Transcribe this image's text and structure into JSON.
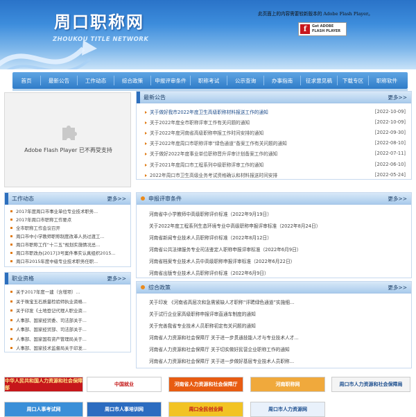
{
  "header": {
    "site_name": "周口职称网",
    "site_name_en": "ZHOUKOU TITLE NETWORK",
    "flash_notice": "此页面上的内容需要较新版本的 Adobe Flash Player。",
    "get_flash_line1": "Get ADOBE",
    "get_flash_line2": "FLASH PLAYER"
  },
  "nav": [
    "首页",
    "最新公告",
    "工作动态",
    "综合政策",
    "申报评审条件",
    "职称考试",
    "公示查询",
    "办事指南",
    "征求意见稿",
    "下载专区",
    "职称软件"
  ],
  "flash_placeholder": "Adobe Flash Player 已不再受支持",
  "latest": {
    "title": "最新公告",
    "more": "更多>>",
    "items": [
      {
        "text": "关于做好我市2022年度卫生高级职称材料报送工作的通知",
        "date": "[2022-10-09]"
      },
      {
        "text": "关于2022年度全市职称评审工作有关问题的通知",
        "date": "[2022-10-09]"
      },
      {
        "text": "关于2022年度河南省高级职称申报工作时间安排的通知",
        "date": "[2022-09-30]"
      },
      {
        "text": "关于2022年度周口市职称评审“绿色通道”备案工作有关问题的通知",
        "date": "[2022-08-10]"
      },
      {
        "text": "关于做好2022年度事业单位职称晋升评审计划备案工作的通知",
        "date": "[2022-07-11]"
      },
      {
        "text": "关于2021年度周口市工程系列中级职称评审工作的通知",
        "date": "[2022-06-10]"
      },
      {
        "text": "2022年周口市卫生高级业务考试资格确认和材料报送时间安排",
        "date": "[2022-05-24]"
      }
    ]
  },
  "work": {
    "title": "工作动态",
    "more": "更多>>",
    "items": [
      "2017年度周口市事业单位专业技术职务...",
      "2017年周口市职称工作要点",
      "全市职称工作会议召开",
      "周口市中小学教师职称制度改革人员过渡工...",
      "周口市职称工作“十二五”规划实施情况总...",
      "周口市职改办[2017]3号案件事实认真组织2015...",
      "周口市2015年度中级专业技术职务任职..."
    ]
  },
  "qual": {
    "title": "职业资格",
    "more": "更多>>",
    "items": [
      "关于2017年度一建（含增项）...",
      "关于珠宝玉石质量检验师执业资格...",
      "关于印发《土地登记代理人职业资...",
      "人事部、国家经贸委、司法部关于...",
      "人事部、国家经贸部、司法部关于...",
      "人事部、国家国有资产管理局关于...",
      "人事部、国家技术监督局关于印发..."
    ]
  },
  "review": {
    "title": "申报评审条件",
    "more": "更多>>",
    "items": [
      "河南省中小学教师中高级职称评价标准（2022年9月19日）",
      "关于2022年度工程系列生态环境专业中高级职称申报评审标准（2022年8月24日）",
      "河南省新闻专业技术人员职称评价标准（2022年8月12日）",
      "河南省公共法律服务专业司法鉴定人职称申报评审标准（2022年6月9日）",
      "河南省档案专业技术人员中高级职称申报评审标准（2022年6月22日）",
      "河南省出版专业技术人员职称评价标准（2022年6月9日）"
    ]
  },
  "policy": {
    "title": "综合政策",
    "more": "更多>>",
    "items": [
      "关于印发 《河南省高层次和急需紧缺人才职称“评聘绿色通道”实施细...",
      "关于试行企业家高级职称申报评审直通车制度的通知",
      "关于完善我省专业技术人员职称初定有关问题的通知",
      "河南省人力资源和社会保障厅 关于进一步贯通技能人才与专业技术人才...",
      "河南省人力资源和社会保障厅 关于切实做好民营企业职称工作的通知",
      "河南省人力资源和社会保障厅 关于进一步做好基层专业技术人员职称..."
    ]
  },
  "banners": [
    {
      "label": "中华人民共和国人力资源和社会保障部",
      "bg": "#c6161b",
      "fg": "#ffe98a"
    },
    {
      "label": "中国就业",
      "bg": "#ffffff",
      "fg": "#c41a1a"
    },
    {
      "label": "河南省人力资源和社会保障厅",
      "bg": "#e85c12",
      "fg": "#ffffff"
    },
    {
      "label": "河南职称网",
      "bg": "#f0a93c",
      "fg": "#ffffff"
    },
    {
      "label": "周口市人力资源和社会保障局",
      "bg": "#f4f4f4",
      "fg": "#1d4f8f"
    },
    {
      "label": "周口人事考试网",
      "bg": "#3a8fd8",
      "fg": "#ffffff"
    },
    {
      "label": "周口市人事培训网",
      "bg": "#2c6cc0",
      "fg": "#ffffff"
    },
    {
      "label": "周口全民创业网",
      "bg": "#f2c324",
      "fg": "#c0161b"
    },
    {
      "label": "周口市人力资源网",
      "bg": "#e9f1fb",
      "fg": "#1d4f8f"
    }
  ]
}
